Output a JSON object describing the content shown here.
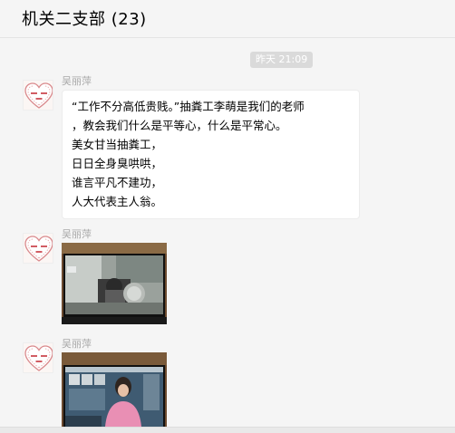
{
  "header": {
    "title": "机关二支部 (23)"
  },
  "timestamp": "昨天 21:09",
  "messages": [
    {
      "sender": "吴丽萍",
      "type": "text",
      "lines": [
        "“工作不分高低贵贱。”抽粪工李萌是我们的老师",
        "，教会我们什么是平等心，什么是平常心。",
        "美女甘当抽粪工，",
        "日日全身臭哄哄，",
        "谁言平凡不建功，",
        "人大代表主人翁。"
      ]
    },
    {
      "sender": "吴丽萍",
      "type": "image"
    },
    {
      "sender": "吴丽萍",
      "type": "image"
    }
  ],
  "colors": {
    "background": "#f5f5f5",
    "bubble": "#ffffff",
    "timestamp_bg": "#dadada",
    "sender_name": "#a8a8a8"
  },
  "icons": {
    "avatar": "heart-avatar-icon"
  }
}
